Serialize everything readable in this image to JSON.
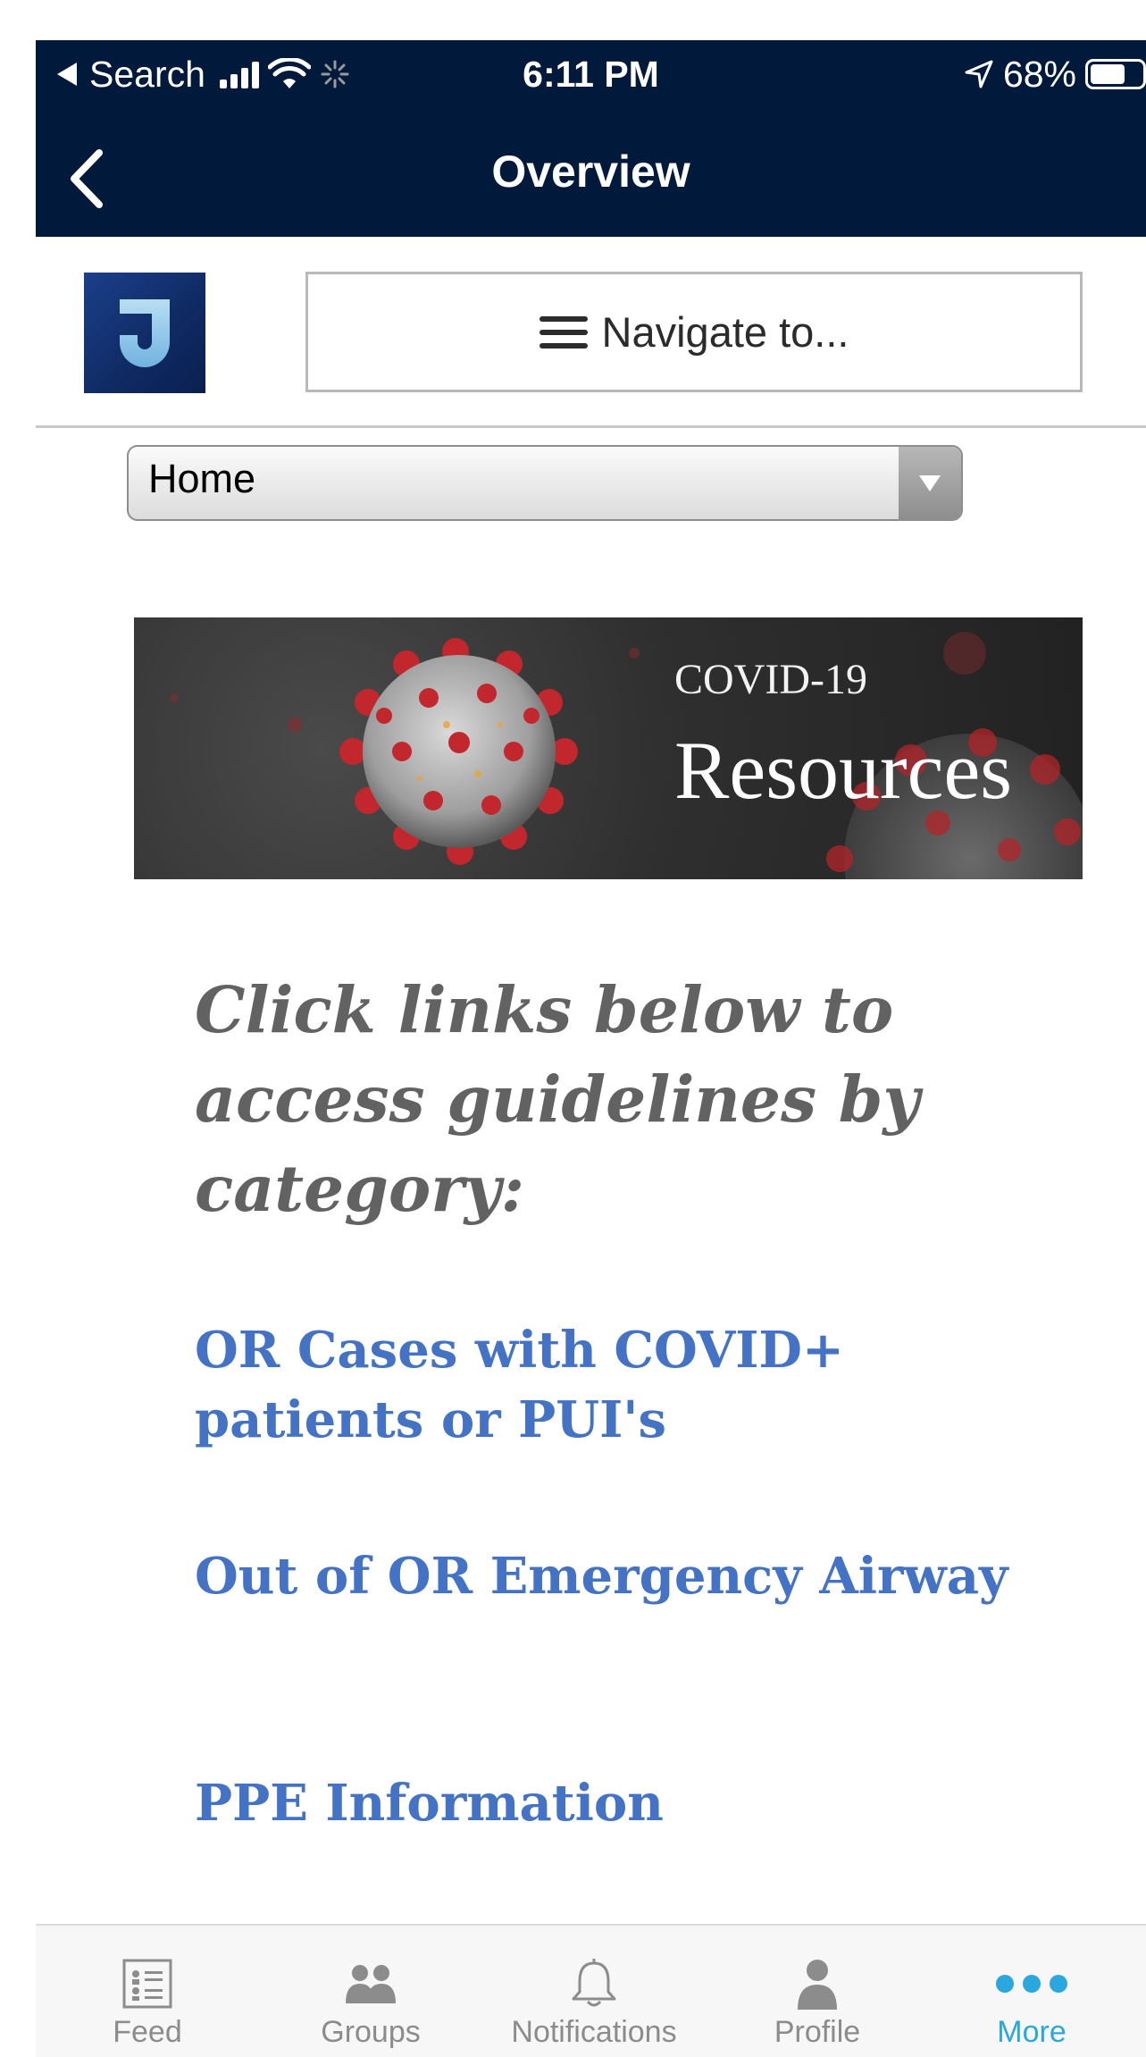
{
  "status_bar": {
    "back_app": "Search",
    "time": "6:11 PM",
    "battery": "68%"
  },
  "nav_bar": {
    "title": "Overview"
  },
  "header": {
    "logo_letter": "J",
    "navigate_label": "Navigate to..."
  },
  "page_select": {
    "selected": "Home"
  },
  "banner": {
    "line1": "COVID-19",
    "line2": "Resources"
  },
  "content": {
    "intro": "Click links below to access guidelines by category:",
    "links": [
      "OR Cases with COVID+ patients or PUI's",
      "Out of OR Emergency Airway",
      "PPE Information"
    ]
  },
  "tab_bar": {
    "tabs": [
      {
        "label": "Feed",
        "icon": "feed-icon"
      },
      {
        "label": "Groups",
        "icon": "groups-icon"
      },
      {
        "label": "Notifications",
        "icon": "bell-icon"
      },
      {
        "label": "Profile",
        "icon": "profile-icon"
      },
      {
        "label": "More",
        "icon": "more-icon"
      }
    ],
    "active": "More"
  },
  "colors": {
    "nav_background": "#011a3c",
    "link": "#4472c4",
    "intro_text": "#626262",
    "tab_active": "#2aa7de",
    "tab_inactive": "#8c8c8c"
  }
}
